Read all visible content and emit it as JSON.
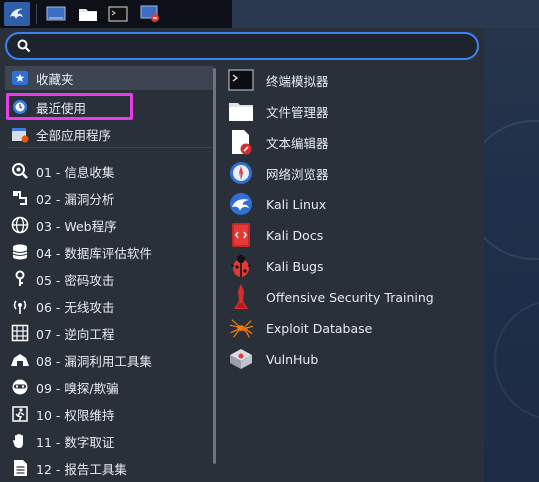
{
  "taskbar": {
    "items": [
      {
        "icon": "kali-dragon-icon"
      },
      {
        "icon": "workspace-icon"
      },
      {
        "icon": "folder-icon"
      },
      {
        "icon": "terminal-icon"
      },
      {
        "icon": "record-icon"
      }
    ]
  },
  "search": {
    "placeholder": "",
    "value": ""
  },
  "categories": [
    {
      "label": "收藏夹",
      "icon": "star-icon"
    },
    {
      "label": "最近使用",
      "icon": "clock-icon"
    },
    {
      "label": "全部应用程序",
      "icon": "all-apps-icon"
    },
    {
      "label": "01 - 信息收集",
      "icon": "magnifier-icon"
    },
    {
      "label": "02 - 漏洞分析",
      "icon": "vulnerability-icon"
    },
    {
      "label": "03 - Web程序",
      "icon": "globe-icon"
    },
    {
      "label": "04 - 数据库评估软件",
      "icon": "database-icon"
    },
    {
      "label": "05 - 密码攻击",
      "icon": "key-icon"
    },
    {
      "label": "06 - 无线攻击",
      "icon": "wireless-icon"
    },
    {
      "label": "07 - 逆向工程",
      "icon": "reverse-icon"
    },
    {
      "label": "08 - 漏洞利用工具集",
      "icon": "exploit-icon"
    },
    {
      "label": "09 - 嗅探/欺骗",
      "icon": "sniff-icon"
    },
    {
      "label": "10 - 权限维持",
      "icon": "persistence-icon"
    },
    {
      "label": "11 - 数字取证",
      "icon": "hand-icon"
    },
    {
      "label": "12 - 报告工具集",
      "icon": "report-icon"
    }
  ],
  "apps": [
    {
      "label": "终端模拟器",
      "icon": "terminal-icon"
    },
    {
      "label": "文件管理器",
      "icon": "folder-icon"
    },
    {
      "label": "文本编辑器",
      "icon": "text-editor-icon"
    },
    {
      "label": "网络浏览器",
      "icon": "browser-icon"
    },
    {
      "label": "Kali Linux",
      "icon": "kali-icon"
    },
    {
      "label": "Kali Docs",
      "icon": "kali-docs-icon"
    },
    {
      "label": "Kali Bugs",
      "icon": "kali-bugs-icon"
    },
    {
      "label": "Offensive Security Training",
      "icon": "offsec-icon"
    },
    {
      "label": "Exploit Database",
      "icon": "exploitdb-icon"
    },
    {
      "label": "VulnHub",
      "icon": "vulnhub-icon"
    }
  ],
  "colors": {
    "accent": "#3b82f6",
    "highlight_box": "#e83ee8",
    "menu_bg": "#2a303a"
  }
}
